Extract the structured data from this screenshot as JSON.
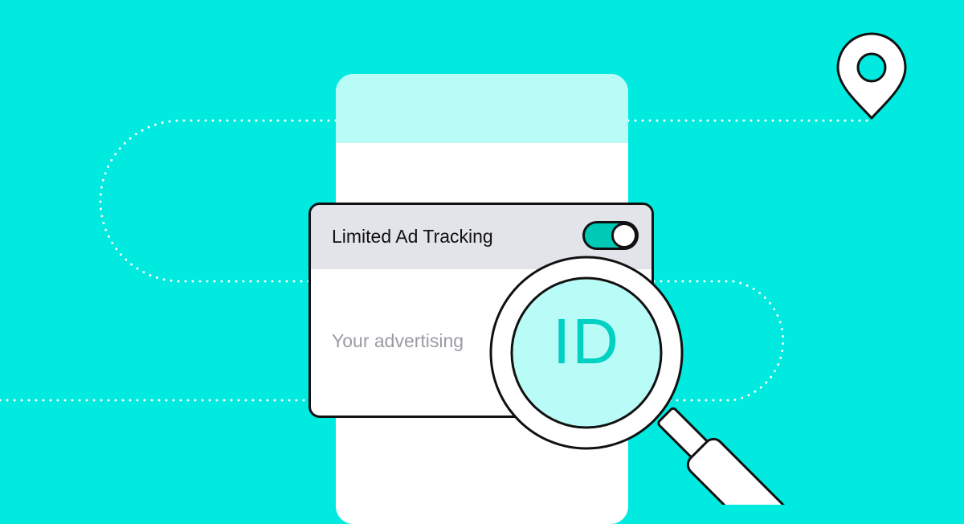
{
  "card": {
    "title": "Limited Ad Tracking",
    "toggle_state": "on",
    "body_text": "Your advertising"
  },
  "magnifier": {
    "label": "ID"
  },
  "colors": {
    "background": "#00EADF",
    "phone_header": "#B9FBF7",
    "card_header": "#E2E4EA",
    "toggle_on": "#00C9B6",
    "lens_fill": "#B9FBF7",
    "id_text": "#00D1C3",
    "outline": "#111111"
  },
  "icons": [
    "location-pin-icon",
    "magnifying-glass-icon",
    "toggle-switch-icon"
  ]
}
